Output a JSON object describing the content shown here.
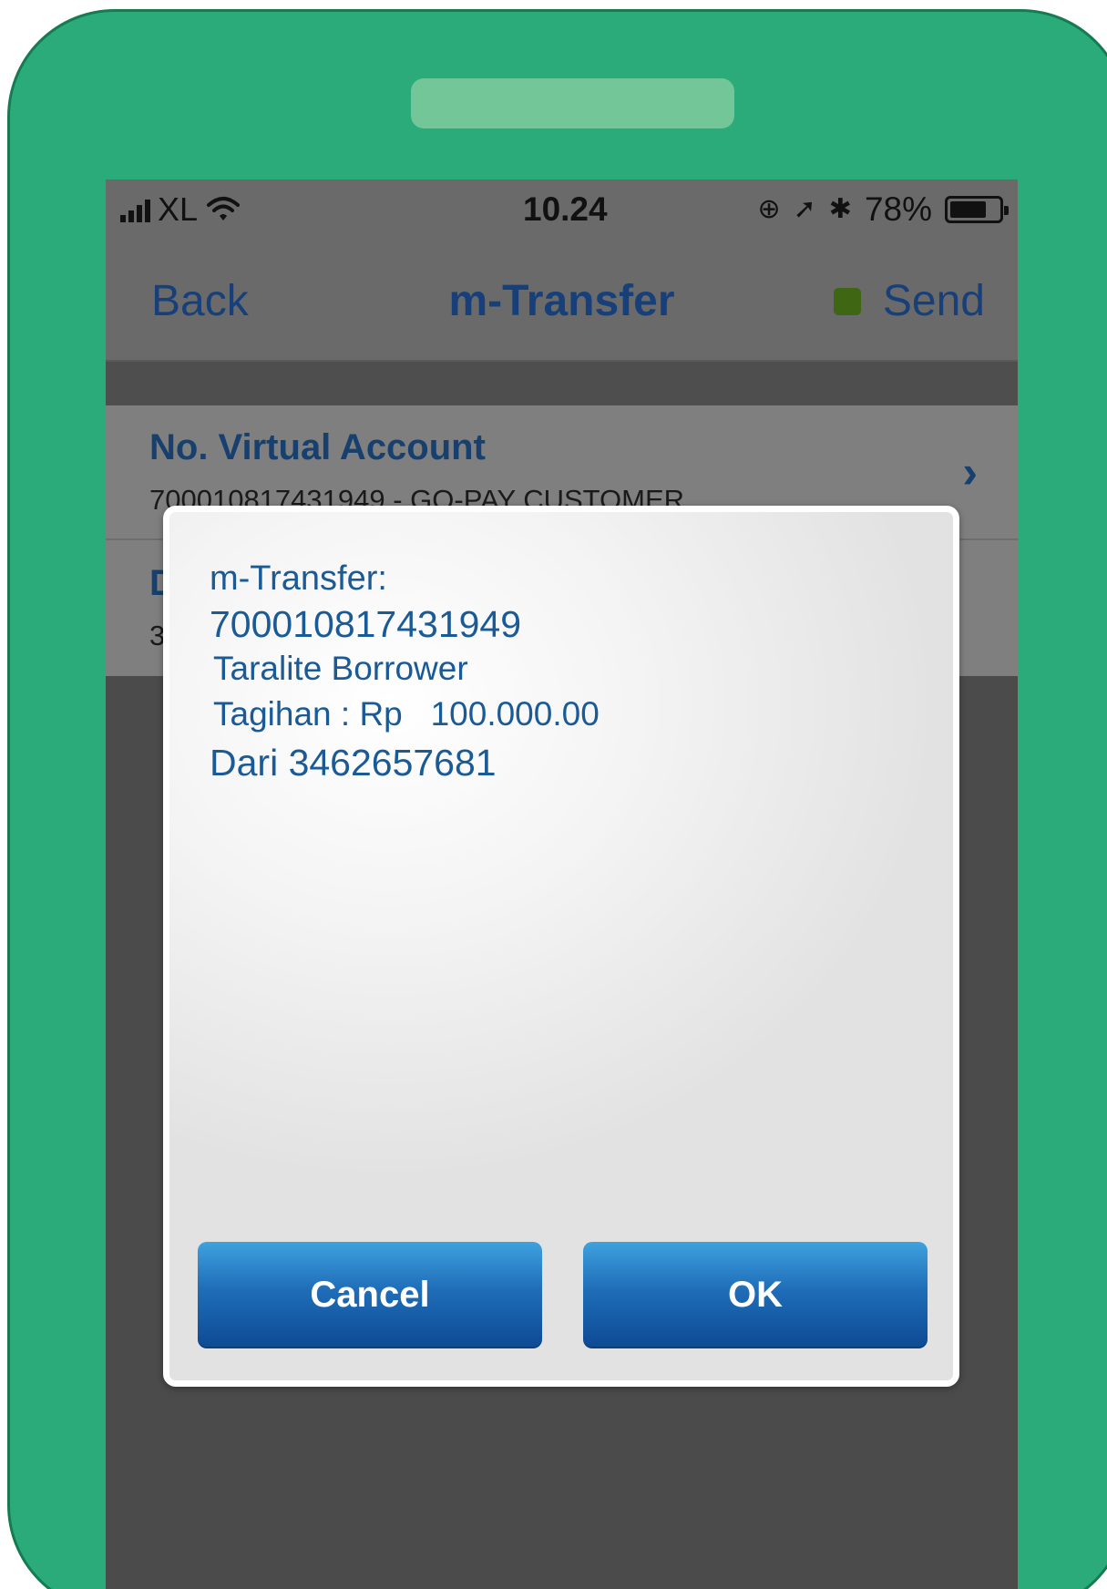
{
  "status_bar": {
    "carrier": "XL",
    "time": "10.24",
    "battery_percent": "78%",
    "battery_level": 0.78,
    "icons": [
      "signal-icon",
      "wifi-icon",
      "orientation-lock-icon",
      "location-icon",
      "bluetooth-icon",
      "battery-icon"
    ]
  },
  "nav": {
    "back_label": "Back",
    "title": "m-Transfer",
    "send_label": "Send"
  },
  "list": {
    "rows": [
      {
        "title": "No. Virtual Account",
        "subtitle": "700010817431949 - GO-PAY CUSTOMER"
      },
      {
        "title": "D",
        "subtitle": "3"
      }
    ]
  },
  "dialog": {
    "line1": "m-Transfer:",
    "line2": "700010817431949",
    "line3": "Taralite Borrower",
    "line4": "Tagihan : Rp   100.000.00",
    "line5": "Dari 3462657681",
    "cancel_label": "Cancel",
    "ok_label": "OK"
  },
  "colors": {
    "frame": "#2aab79",
    "accent_text": "#17407a",
    "dialog_text": "#1a5a96",
    "button_top": "#3fa2de",
    "button_bottom": "#0d4a93"
  }
}
